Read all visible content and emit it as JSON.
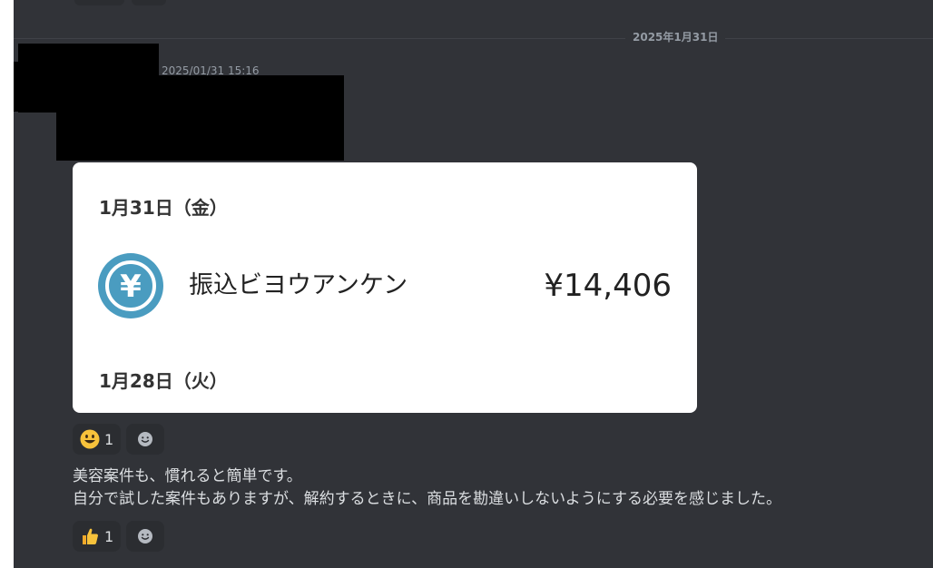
{
  "divider": {
    "date": "2025年1月31日"
  },
  "message1": {
    "timestamp": "2025/01/31 15:16"
  },
  "card": {
    "date1": "1月31日（金）",
    "icon": "yen-circle-icon",
    "merchant": "振込ビヨウアンケン",
    "amount": "¥14,406",
    "date2": "1月28日（火）",
    "accent": "#4a9cc0"
  },
  "reactions1": [
    {
      "emoji": "grinning-face-emoji",
      "count": "1"
    },
    {
      "emoji": "add-reaction-icon"
    }
  ],
  "message2": {
    "lines": [
      "美容案件も、慣れると簡単です。",
      "自分で試した案件もありますが、解約するときに、商品を勘違いしないようにする必要を感じました。"
    ]
  },
  "reactions2": [
    {
      "emoji": "thumbs-up-emoji",
      "count": "1"
    },
    {
      "emoji": "add-reaction-icon"
    }
  ]
}
